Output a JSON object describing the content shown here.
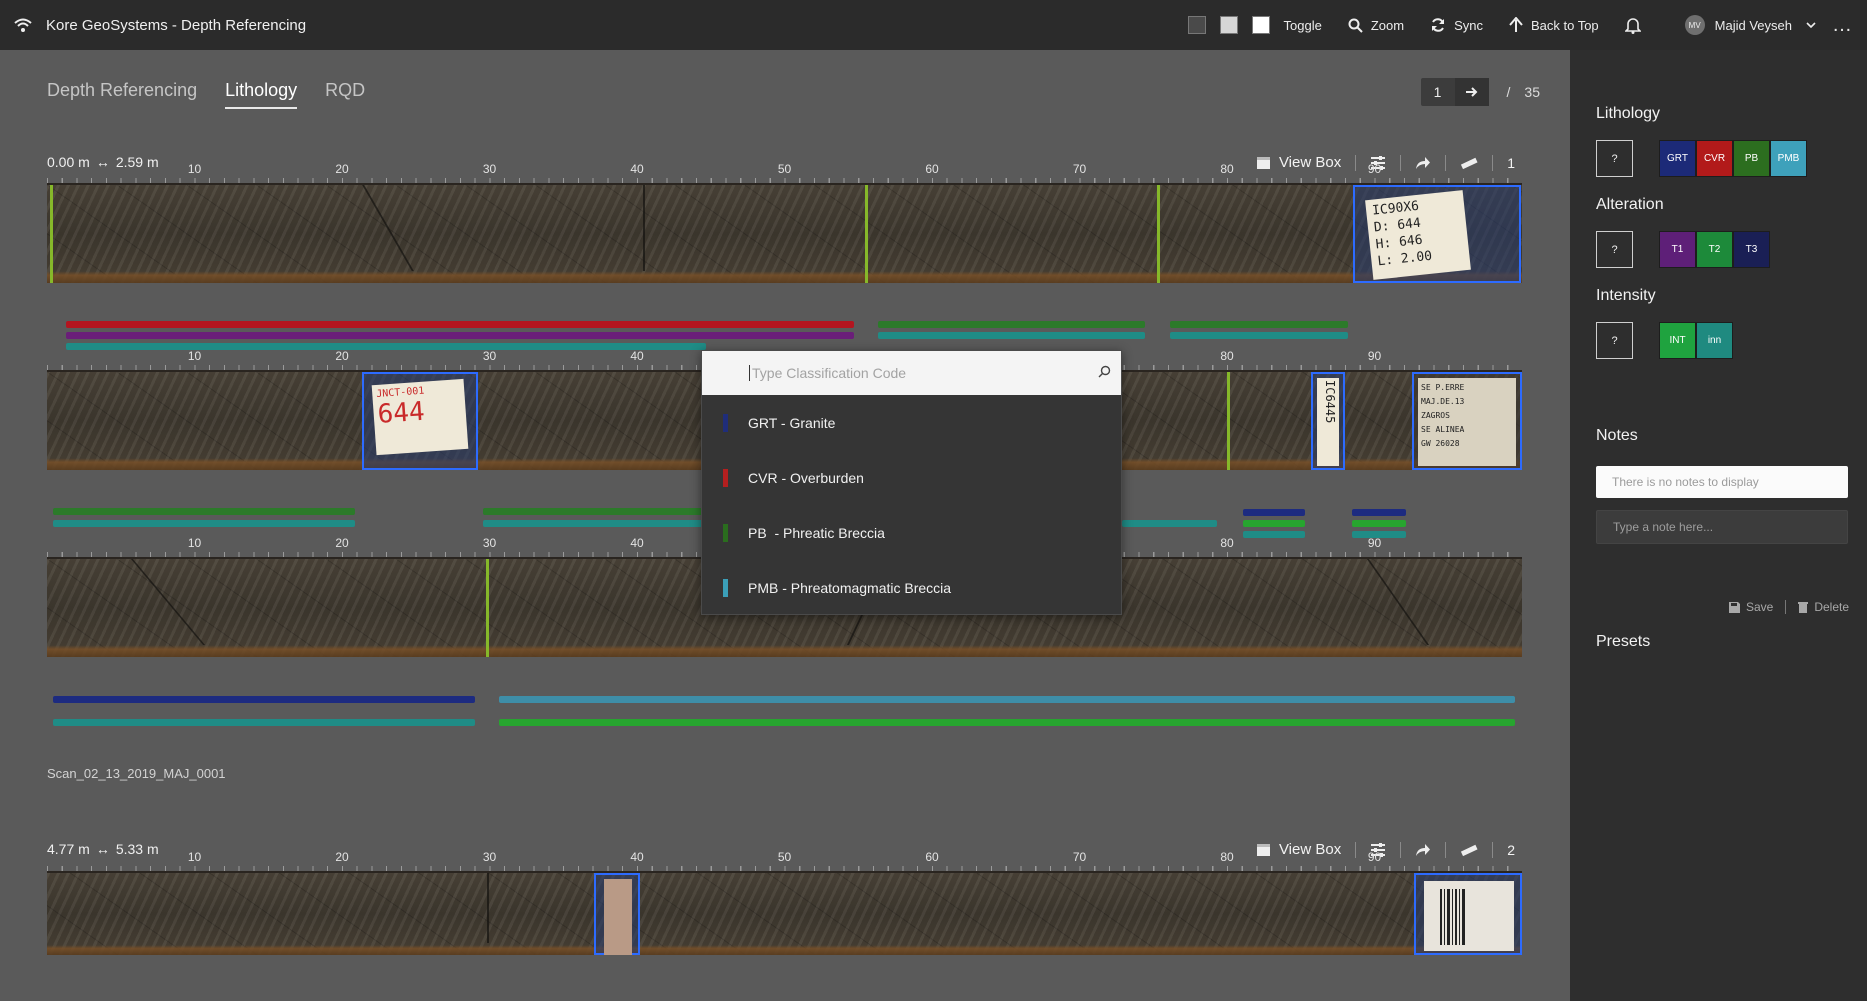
{
  "app": {
    "title": "Kore GeoSystems -  Depth Referencing"
  },
  "toolbar": {
    "toggle_label": "Toggle",
    "zoom_label": "Zoom",
    "sync_label": "Sync",
    "back_to_top_label": "Back to Top",
    "user_initials": "MV",
    "user_name": "Majid Veyseh",
    "swatches": [
      "#4a4a4a",
      "#d6d6d6",
      "#ffffff"
    ]
  },
  "tabs": [
    {
      "label": "Depth Referencing",
      "active": false
    },
    {
      "label": "Lithology",
      "active": true
    },
    {
      "label": "RQD",
      "active": false
    }
  ],
  "pager": {
    "current": "1",
    "separator": "/",
    "total": "35"
  },
  "ruler_labels": [
    "10",
    "20",
    "30",
    "40",
    "50",
    "60",
    "70",
    "80",
    "90"
  ],
  "boxes": [
    {
      "range_from": "0.00 m",
      "range_to": "2.59 m",
      "view_box_label": "View Box",
      "index": "1",
      "scan_id": "Scan_02_13_2019_MAJ_0001",
      "tags": {
        "row1": [
          "IC90X6",
          "D: 644",
          "H: 646",
          "L: 2.00"
        ],
        "row2_a": [
          "JNCT-001",
          "644"
        ],
        "row2_b": "IC6445",
        "row2_c": [
          "SE P.ERRE",
          "MAJ.DE.13",
          "ZAGROS",
          "SE ALINEA",
          "GW 26028"
        ]
      }
    },
    {
      "range_from": "4.77 m",
      "range_to": "5.33 m",
      "view_box_label": "View Box",
      "index": "2"
    }
  ],
  "dropdown": {
    "placeholder": "Type Classification Code",
    "items": [
      {
        "label": "GRT - Granite",
        "color": "#1f2d7a"
      },
      {
        "label": "CVR - Overburden",
        "color": "#b41f1f"
      },
      {
        "label": "PB  - Phreatic Breccia",
        "color": "#2a6d1e"
      },
      {
        "label": "PMB - Phreatomagmatic Breccia",
        "color": "#3b9fb8"
      }
    ]
  },
  "sidebar": {
    "lithology": {
      "title": "Lithology",
      "unknown": "?",
      "chips": [
        {
          "label": "GRT",
          "color": "#1c2a78"
        },
        {
          "label": "CVR",
          "color": "#b21a1a"
        },
        {
          "label": "PB",
          "color": "#2c6e1f"
        },
        {
          "label": "PMB",
          "color": "#3ea1bb"
        }
      ]
    },
    "alteration": {
      "title": "Alteration",
      "unknown": "?",
      "chips": [
        {
          "label": "T1",
          "color": "#5e1f78"
        },
        {
          "label": "T2",
          "color": "#1d8a3a"
        },
        {
          "label": "T3",
          "color": "#1a1f55"
        }
      ]
    },
    "intensity": {
      "title": "Intensity",
      "unknown": "?",
      "chips": [
        {
          "label": "INT",
          "color": "#1fa33f"
        },
        {
          "label": "inn",
          "color": "#1f8a80"
        }
      ]
    },
    "notes": {
      "title": "Notes",
      "empty_text": "There is no notes to display",
      "input_placeholder": "Type a note here...",
      "save_label": "Save",
      "delete_label": "Delete"
    },
    "presets": {
      "title": "Presets"
    }
  },
  "colors": {
    "red": "#b3151f",
    "purple": "#6a1e79",
    "teal": "#1f8c86",
    "green": "#27a52f",
    "navy": "#1d2b80",
    "marker": "#86b82a",
    "label_border": "#2d6bff"
  }
}
